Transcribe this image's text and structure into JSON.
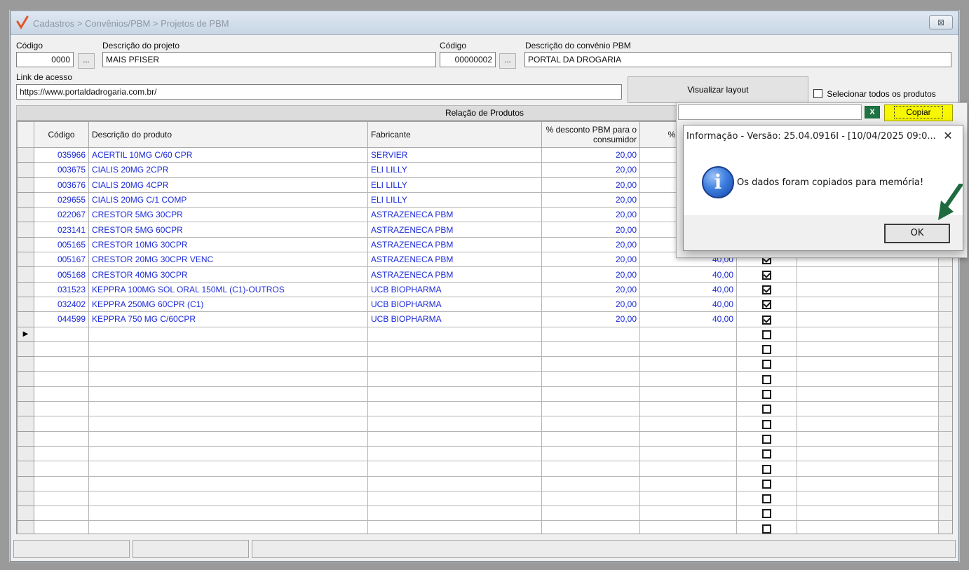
{
  "window": {
    "breadcrumb": "Cadastros > Convênios/PBM > Projetos de PBM",
    "close_label": "⊠"
  },
  "form": {
    "codigo_label": "Código",
    "codigo_value": "0000",
    "descricao_projeto_label": "Descrição do projeto",
    "descricao_projeto_value": "MAIS PFISER",
    "codigo_convenio_label": "Código",
    "codigo_convenio_value": "00000002",
    "descricao_convenio_label": "Descrição do convênio PBM",
    "descricao_convenio_value": "PORTAL DA DROGARIA",
    "link_label": "Link de acesso",
    "link_value": "https://www.portaldadrogaria.com.br/",
    "lookup_label": "...",
    "visualizar_label": "Visualizar layout",
    "selecionar_todos_label": "Selecionar todos os produtos"
  },
  "grid": {
    "caption": "Relação de Produtos",
    "columns": {
      "codigo": "Código",
      "descricao": "Descrição do produto",
      "fabricante": "Fabricante",
      "desc_consumidor": "% desconto PBM para o consumidor",
      "desc_other": "% descont para a"
    },
    "rows": [
      {
        "codigo": "035966",
        "descricao": "ACERTIL 10MG C/60 CPR",
        "fabricante": "SERVIER",
        "desc_consumidor": "20,00",
        "desc_other": "",
        "checked": false
      },
      {
        "codigo": "003675",
        "descricao": "CIALIS 20MG 2CPR",
        "fabricante": "ELI LILLY",
        "desc_consumidor": "20,00",
        "desc_other": "",
        "checked": false
      },
      {
        "codigo": "003676",
        "descricao": "CIALIS 20MG 4CPR",
        "fabricante": "ELI LILLY",
        "desc_consumidor": "20,00",
        "desc_other": "",
        "checked": false
      },
      {
        "codigo": "029655",
        "descricao": "CIALIS 20MG C/1 COMP",
        "fabricante": "ELI LILLY",
        "desc_consumidor": "20,00",
        "desc_other": "",
        "checked": false
      },
      {
        "codigo": "022067",
        "descricao": "CRESTOR  5MG 30CPR",
        "fabricante": "ASTRAZENECA PBM",
        "desc_consumidor": "20,00",
        "desc_other": "",
        "checked": false
      },
      {
        "codigo": "023141",
        "descricao": "CRESTOR  5MG 60CPR",
        "fabricante": "ASTRAZENECA PBM",
        "desc_consumidor": "20,00",
        "desc_other": "",
        "checked": false
      },
      {
        "codigo": "005165",
        "descricao": "CRESTOR 10MG 30CPR",
        "fabricante": "ASTRAZENECA PBM",
        "desc_consumidor": "20,00",
        "desc_other": "",
        "checked": false
      },
      {
        "codigo": "005167",
        "descricao": "CRESTOR 20MG 30CPR VENC",
        "fabricante": "ASTRAZENECA PBM",
        "desc_consumidor": "20,00",
        "desc_other": "40,00",
        "checked": true
      },
      {
        "codigo": "005168",
        "descricao": "CRESTOR 40MG 30CPR",
        "fabricante": "ASTRAZENECA PBM",
        "desc_consumidor": "20,00",
        "desc_other": "40,00",
        "checked": true
      },
      {
        "codigo": "031523",
        "descricao": "KEPPRA 100MG SOL ORAL 150ML (C1)-OUTROS",
        "fabricante": "UCB BIOPHARMA",
        "desc_consumidor": "20,00",
        "desc_other": "40,00",
        "checked": true
      },
      {
        "codigo": "032402",
        "descricao": "KEPPRA 250MG 60CPR (C1)",
        "fabricante": "UCB BIOPHARMA",
        "desc_consumidor": "20,00",
        "desc_other": "40,00",
        "checked": true
      },
      {
        "codigo": "044599",
        "descricao": "KEPPRA 750 MG C/60CPR",
        "fabricante": "UCB BIOPHARMA",
        "desc_consumidor": "20,00",
        "desc_other": "40,00",
        "checked": true
      }
    ],
    "empty_rows": 14,
    "current_row_marker": "▶"
  },
  "toolbar": {
    "excel_icon": "excel-icon",
    "excel_glyph": "X",
    "copy_label": "Copiar"
  },
  "dialog": {
    "title": "Informação - Versão: 25.04.0916I - [10/04/2025 09:0...",
    "close_label": "✕",
    "message": "Os dados foram copiados para memória!",
    "ok_label": "OK",
    "icon": "info-icon",
    "icon_glyph": "i"
  },
  "colors": {
    "data_text": "#1c2bd8",
    "copy_highlight": "#f7f700",
    "arrow": "#1f6b3f"
  }
}
